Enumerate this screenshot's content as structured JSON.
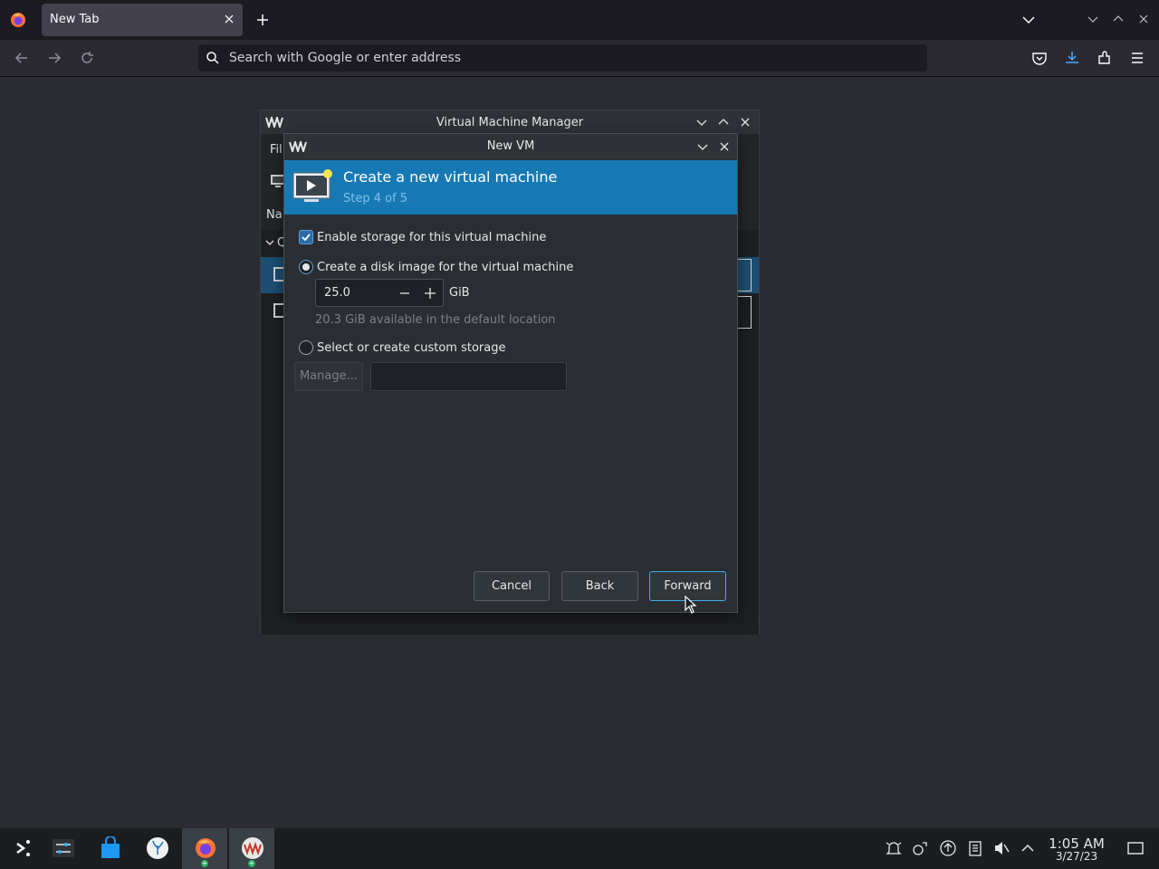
{
  "browser": {
    "tab_title": "New Tab",
    "url_placeholder": "Search with Google or enter address"
  },
  "vmm": {
    "title": "Virtual Machine Manager",
    "menu_partial": "Fil",
    "column_header_partial": "Na",
    "group_partial": "Q"
  },
  "dialog": {
    "title": "New VM",
    "banner_title": "Create a new virtual machine",
    "banner_step": "Step 4 of 5",
    "enable_storage_label": "Enable storage for this virtual machine",
    "enable_storage_checked": true,
    "create_disk_label": "Create a disk image for the virtual machine",
    "disk_size": "25.0",
    "disk_unit": "GiB",
    "available_text": "20.3 GiB available in the default location",
    "custom_storage_label": "Select or create custom storage",
    "manage_label": "Manage...",
    "storage_path": "",
    "cancel_label": "Cancel",
    "back_label": "Back",
    "forward_label": "Forward"
  },
  "taskbar": {
    "time": "1:05 AM",
    "date": "3/27/23"
  },
  "colors": {
    "accent": "#1779b4",
    "focus": "#3daee9",
    "background": "#2a2c32"
  }
}
